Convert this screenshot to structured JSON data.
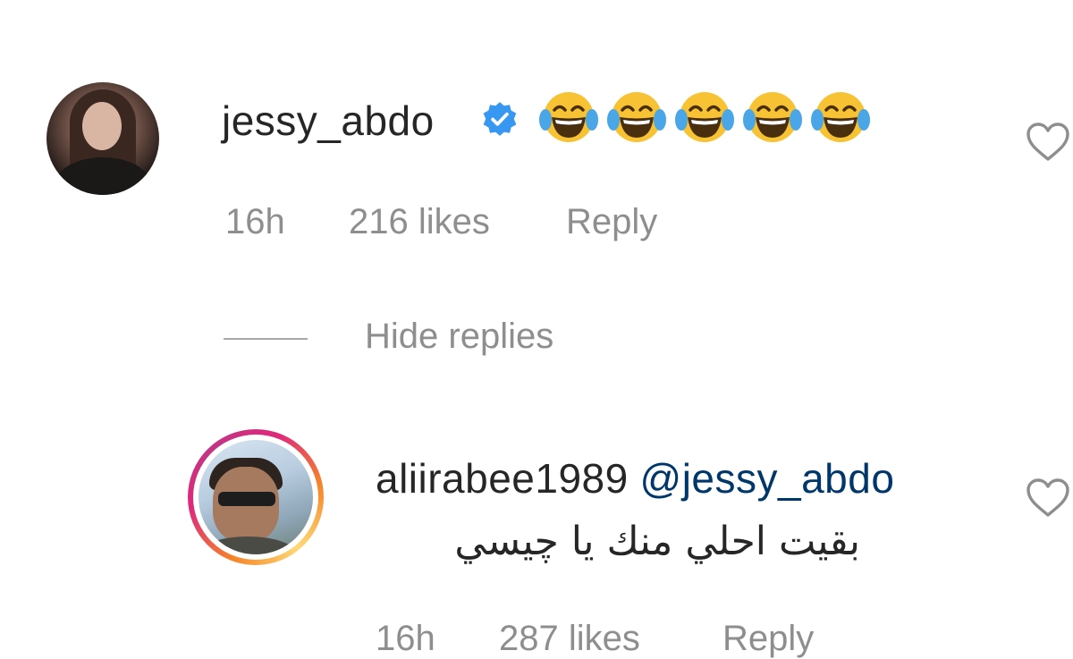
{
  "comments": [
    {
      "username": "jessy_abdo",
      "verified": true,
      "text_emojis": [
        "😂",
        "😂",
        "😂",
        "😂",
        "😂"
      ],
      "time": "16h",
      "likes": "216 likes",
      "reply_label": "Reply"
    }
  ],
  "replies_toggle": {
    "label": "Hide replies"
  },
  "replies": [
    {
      "username": "aliirabee1989",
      "mention": "@jessy_abdo",
      "text": "بقيت احلي منك يا چيسي",
      "time": "16h",
      "likes": "287 likes",
      "reply_label": "Reply"
    }
  ],
  "colors": {
    "text_primary": "#262626",
    "text_secondary": "#8e8e8e",
    "mention": "#00376b",
    "verified_badge": "#3897f0"
  }
}
